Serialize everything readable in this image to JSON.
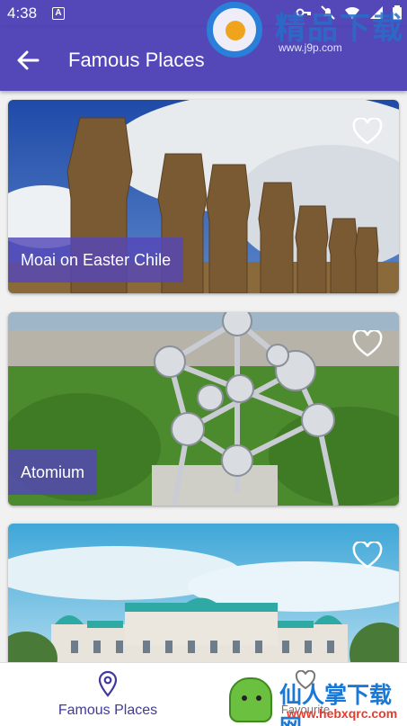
{
  "status_bar": {
    "time": "4:38",
    "notification_icon": "A"
  },
  "app_bar": {
    "title": "Famous Places",
    "back_icon": "arrow-left-icon"
  },
  "watermark_top": {
    "text": "精品下载",
    "url": "www.j9p.com"
  },
  "places": [
    {
      "name": "Moai on Easter Chile",
      "favorite": false
    },
    {
      "name": "Atomium",
      "favorite": false
    },
    {
      "name": "",
      "favorite": false
    }
  ],
  "bottom_nav": {
    "items": [
      {
        "label": "Famous Places",
        "icon": "location-pin-icon",
        "active": true
      },
      {
        "label": "Favourite",
        "icon": "heart-icon",
        "active": false
      }
    ]
  },
  "watermark_bottom": {
    "text": "仙人掌下载网",
    "url": "www.hebxqrc.com"
  },
  "colors": {
    "primary": "#5447b8",
    "label_bg": "#5447b8",
    "nav_active": "#3f3a9c"
  }
}
